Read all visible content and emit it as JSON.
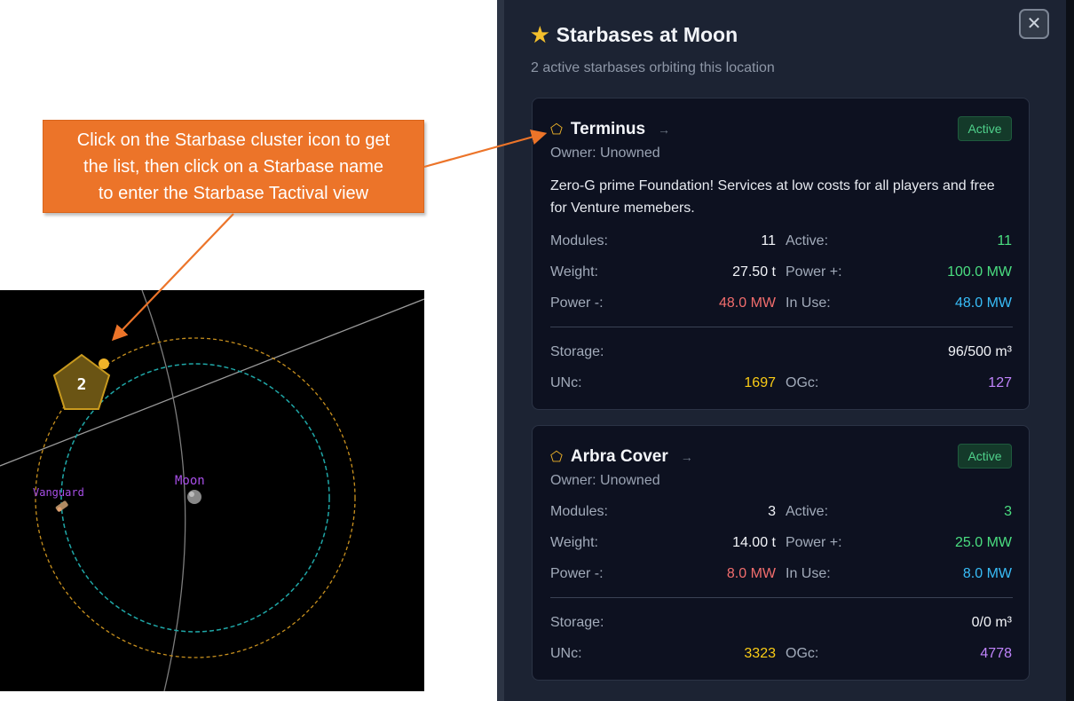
{
  "callout": {
    "lines": [
      "Click on the Starbase cluster icon to get",
      "the list, then click on a Starbase name",
      "to enter the Starbase Tactival view"
    ]
  },
  "map": {
    "cluster_count": "2",
    "moon_label": "Moon",
    "vanguard_label": "Vanguard"
  },
  "panel": {
    "title": "Starbases at Moon",
    "subtitle": "2 active starbases orbiting this location",
    "close_label": "✕",
    "starbases": [
      {
        "name": "Terminus",
        "status": "Active",
        "owner": "Owner: Unowned",
        "description": "Zero-G prime Foundation! Services at low costs for all players and free for Venture memebers.",
        "modules_label": "Modules:",
        "modules": "11",
        "active_label": "Active:",
        "active": "11",
        "weight_label": "Weight:",
        "weight": "27.50 t",
        "power_plus_label": "Power +:",
        "power_plus": "100.0 MW",
        "power_minus_label": "Power -:",
        "power_minus": "48.0 MW",
        "in_use_label": "In Use:",
        "in_use": "48.0 MW",
        "storage_label": "Storage:",
        "storage": "96/500 m³",
        "unc_label": "UNc:",
        "unc": "1697",
        "ogc_label": "OGc:",
        "ogc": "127"
      },
      {
        "name": "Arbra Cover",
        "status": "Active",
        "owner": "Owner: Unowned",
        "modules_label": "Modules:",
        "modules": "3",
        "active_label": "Active:",
        "active": "3",
        "weight_label": "Weight:",
        "weight": "14.00 t",
        "power_plus_label": "Power +:",
        "power_plus": "25.0 MW",
        "power_minus_label": "Power -:",
        "power_minus": "8.0 MW",
        "in_use_label": "In Use:",
        "in_use": "8.0 MW",
        "storage_label": "Storage:",
        "storage": "0/0 m³",
        "unc_label": "UNc:",
        "unc": "3323",
        "ogc_label": "OGc:",
        "ogc": "4778"
      }
    ]
  },
  "colors": {
    "callout_bg": "#ec7429",
    "panel_bg": "#1c2333",
    "card_bg": "#0d1120",
    "active_badge": "#4ade80",
    "cluster_gold": "#f0b429",
    "label_purple": "#a84fe8"
  },
  "icons": {
    "title_icon": "star-icon",
    "starbase_icon": "pentagon-icon",
    "link_icon": "arrow-right-icon",
    "close_icon": "close-icon"
  }
}
